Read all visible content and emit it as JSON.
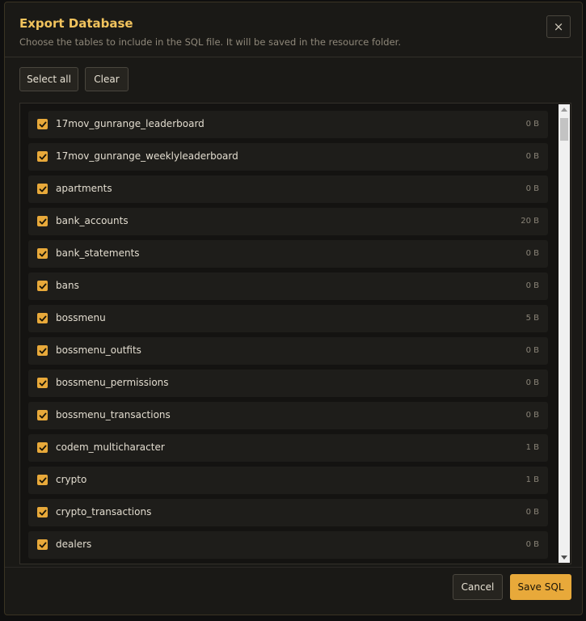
{
  "dialog": {
    "title": "Export Database",
    "subtitle": "Choose the tables to include in the SQL file. It will be saved in the resource folder.",
    "close_icon": "×"
  },
  "toolbar": {
    "select_all_label": "Select all",
    "clear_label": "Clear"
  },
  "tables": [
    {
      "name": "17mov_gunrange_leaderboard",
      "size": "0 B",
      "checked": true
    },
    {
      "name": "17mov_gunrange_weeklyleaderboard",
      "size": "0 B",
      "checked": true
    },
    {
      "name": "apartments",
      "size": "0 B",
      "checked": true
    },
    {
      "name": "bank_accounts",
      "size": "20 B",
      "checked": true
    },
    {
      "name": "bank_statements",
      "size": "0 B",
      "checked": true
    },
    {
      "name": "bans",
      "size": "0 B",
      "checked": true
    },
    {
      "name": "bossmenu",
      "size": "5 B",
      "checked": true
    },
    {
      "name": "bossmenu_outfits",
      "size": "0 B",
      "checked": true
    },
    {
      "name": "bossmenu_permissions",
      "size": "0 B",
      "checked": true
    },
    {
      "name": "bossmenu_transactions",
      "size": "0 B",
      "checked": true
    },
    {
      "name": "codem_multicharacter",
      "size": "1 B",
      "checked": true
    },
    {
      "name": "crypto",
      "size": "1 B",
      "checked": true
    },
    {
      "name": "crypto_transactions",
      "size": "0 B",
      "checked": true
    },
    {
      "name": "dealers",
      "size": "0 B",
      "checked": true
    }
  ],
  "footer": {
    "cancel_label": "Cancel",
    "save_label": "Save SQL"
  },
  "colors": {
    "accent": "#e8a93a",
    "title": "#f1c35d",
    "background": "#1a1916"
  }
}
